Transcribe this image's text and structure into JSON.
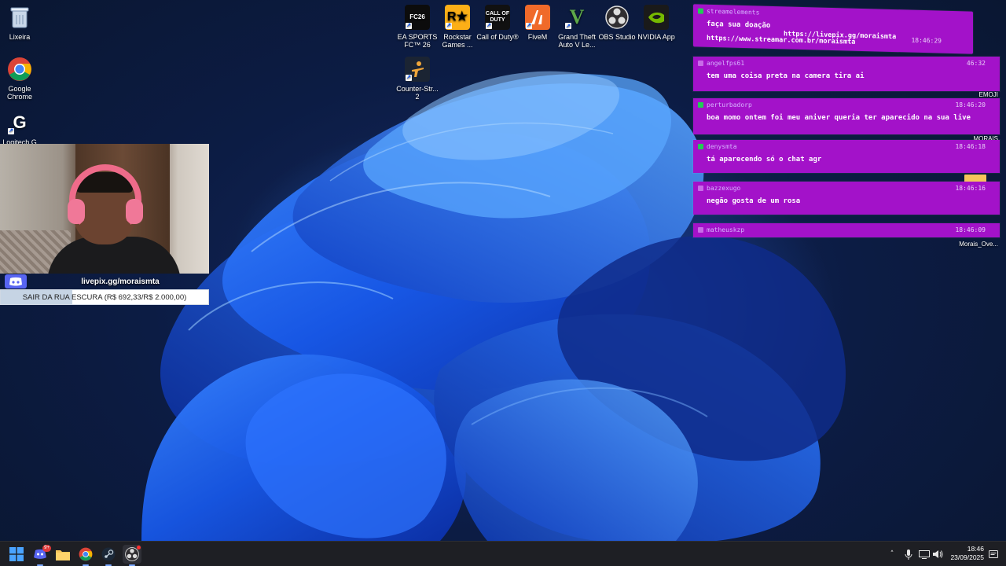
{
  "desktop": {
    "icons": [
      {
        "id": "lixeira",
        "label": "Lixeira",
        "icon": "recycle-bin-icon"
      },
      {
        "id": "chrome",
        "label": "Google Chrome",
        "icon": "chrome-icon"
      },
      {
        "id": "logitech",
        "label": "Logitech G",
        "icon": "logitech-g-icon"
      },
      {
        "id": "easports",
        "label": "EA SPORTS FC™ 26",
        "icon": "ea-fc-icon",
        "glyph": "FC26"
      },
      {
        "id": "rockstar",
        "label": "Rockstar Games ...",
        "icon": "rockstar-icon",
        "glyph": "R★"
      },
      {
        "id": "callofduty",
        "label": "Call of Duty®",
        "icon": "call-of-duty-icon",
        "glyph": "CALL OF DUTY"
      },
      {
        "id": "fivem",
        "label": "FiveM",
        "icon": "fivem-icon"
      },
      {
        "id": "gta",
        "label": "Grand Theft Auto V Le...",
        "icon": "gta-v-icon",
        "glyph": "V"
      },
      {
        "id": "obs",
        "label": "OBS Studio",
        "icon": "obs-icon"
      },
      {
        "id": "nvidia",
        "label": "NVIDIA App",
        "icon": "nvidia-icon"
      },
      {
        "id": "cs2",
        "label": "Counter-Str... 2",
        "icon": "counter-strike-icon"
      }
    ]
  },
  "overlay": {
    "livepix_url": "livepix.gg/moraismta",
    "goal": {
      "text": "SAIR DA RUA ESCURA (R$ 692,33/R$ 2.000,00)",
      "progress": 0.3462
    }
  },
  "chat": {
    "messages": [
      {
        "user": "streamelements",
        "time": "18:46:29",
        "text": "faça sua doação",
        "text2": "https://livepix.gg/moraismta",
        "text3": "https://www.streamar.com.br/moraismta",
        "side": "",
        "dot": "#22cc55"
      },
      {
        "user": "angelfps61",
        "time": "46:32",
        "text": "tem uma coisa preta na camera tira ai",
        "side": "EMOJI",
        "dot": "#c86be8"
      },
      {
        "user": "perturbadorp",
        "time": "18:46:20",
        "text": "boa momo ontem foi meu aniver queria ter aparecido na sua live",
        "side": "MORAIS",
        "dot": "#22cc55"
      },
      {
        "user": "denysmta",
        "time": "18:46:18",
        "text": "tá aparecendo só o chat agr",
        "side": "",
        "dot": "#22cc55"
      },
      {
        "user": "bazzexugo",
        "time": "18:46:16",
        "text": "negão gosta de um rosa",
        "side": "",
        "dot": "#c86be8"
      },
      {
        "user": "matheuskzp",
        "time": "18:46:09",
        "text": "",
        "side": "Morais_Ove...",
        "dot": "#c86be8"
      }
    ]
  },
  "taskbar": {
    "items": [
      {
        "id": "start",
        "icon": "windows-start-icon"
      },
      {
        "id": "discord",
        "icon": "discord-icon",
        "badge": "9+"
      },
      {
        "id": "explorer",
        "icon": "folder-icon"
      },
      {
        "id": "chrome",
        "icon": "chrome-icon"
      },
      {
        "id": "steam",
        "icon": "steam-icon"
      },
      {
        "id": "obs",
        "icon": "obs-icon"
      }
    ],
    "tray": {
      "chevron": "˄",
      "time": "18:46",
      "date": "23/09/2025"
    }
  },
  "colors": {
    "chat_bg": "#a312c9",
    "taskbar_bg": "#1e1f24",
    "accent": "#0a58ff"
  }
}
